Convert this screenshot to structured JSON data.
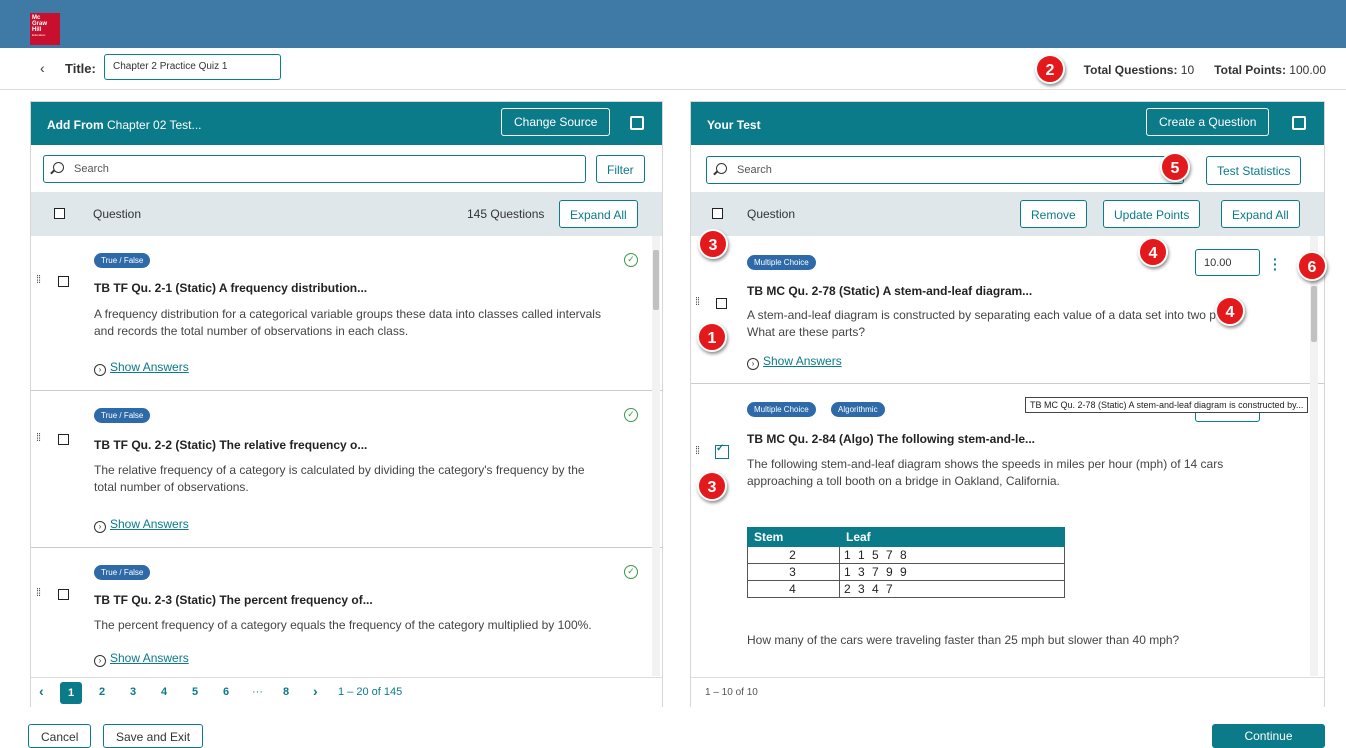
{
  "brand": {
    "logo_lines": [
      "Mc",
      "Graw",
      "Hill"
    ],
    "logo_sub": "Education",
    "color": "#3f79a6",
    "accent": "#0b7a89",
    "badge_color": "#e4191c"
  },
  "header": {
    "back_icon": "‹",
    "title_label": "Title:",
    "title_value": "Chapter 2 Practice Quiz 1",
    "total_questions_label": "Total Questions:",
    "total_questions_value": "10",
    "total_points_label": "Total Points:",
    "total_points_value": "100.00"
  },
  "left": {
    "title_bold": "Add From",
    "title_rest": "Chapter 02 Test...",
    "change_source": "Change Source",
    "search_placeholder": "Search",
    "filter": "Filter",
    "col_question": "Question",
    "count": "145 Questions",
    "expand_all": "Expand All",
    "items": [
      {
        "tag": "True / False",
        "title": "TB TF Qu. 2-1 (Static) A frequency distribution...",
        "text1": "A frequency distribution for a categorical variable groups these data into classes called intervals",
        "text2": "and records the total number of observations in each class.",
        "show": "Show Answers"
      },
      {
        "tag": "True / False",
        "title": "TB TF Qu. 2-2 (Static) The relative frequency o...",
        "text1": "The relative frequency of a category is calculated by dividing the category's frequency by the",
        "text2": "total number of observations.",
        "show": "Show Answers"
      },
      {
        "tag": "True / False",
        "title": "TB TF Qu. 2-3 (Static) The percent frequency of...",
        "text1": "The percent frequency of a category equals the frequency of the category multiplied by 100%.",
        "text2": "",
        "show": "Show Answers"
      }
    ],
    "pager": {
      "prev": "‹",
      "pages": [
        "1",
        "2",
        "3",
        "4",
        "5",
        "6",
        "···",
        "8"
      ],
      "next": "›",
      "range": "1 – 20 of 145"
    }
  },
  "right": {
    "title": "Your Test",
    "create": "Create a Question",
    "search_placeholder": "Search",
    "stats": "Test Statistics",
    "col_question": "Question",
    "remove": "Remove",
    "update_points": "Update Points",
    "expand_all": "Expand All",
    "item1": {
      "tag": "Multiple Choice",
      "points": "10.00",
      "title": "TB MC Qu. 2-78 (Static) A stem-and-leaf diagram...",
      "text1": "A stem-and-leaf diagram is constructed by separating each value of a data set into two parts.",
      "text2": "What are these parts?",
      "show": "Show Answers"
    },
    "item2": {
      "tags": [
        "Multiple Choice",
        "Algorithmic"
      ],
      "title": "TB MC Qu. 2-84 (Algo) The following stem-and-le...",
      "text1": "The following stem-and-leaf diagram shows the speeds in miles per hour (mph) of 14 cars",
      "text2": "approaching a toll booth on a bridge in Oakland, California.",
      "table_head": [
        "Stem",
        "Leaf"
      ],
      "rows": [
        [
          "2",
          "1 1 5 7 8"
        ],
        [
          "3",
          "1 3 7 9 9"
        ],
        [
          "4",
          "2 3 4 7"
        ]
      ],
      "question": "How many of the cars were traveling faster than 25 mph but slower than 40 mph?"
    },
    "tooltip": "TB MC Qu. 2-78 (Static) A stem-and-leaf diagram is constructed by...",
    "footer_range": "1 – 10 of 10"
  },
  "callouts": [
    "1",
    "2",
    "3",
    "3",
    "4",
    "4",
    "5",
    "6"
  ],
  "bottom": {
    "cancel": "Cancel",
    "save_exit": "Save and Exit",
    "continue": "Continue"
  }
}
